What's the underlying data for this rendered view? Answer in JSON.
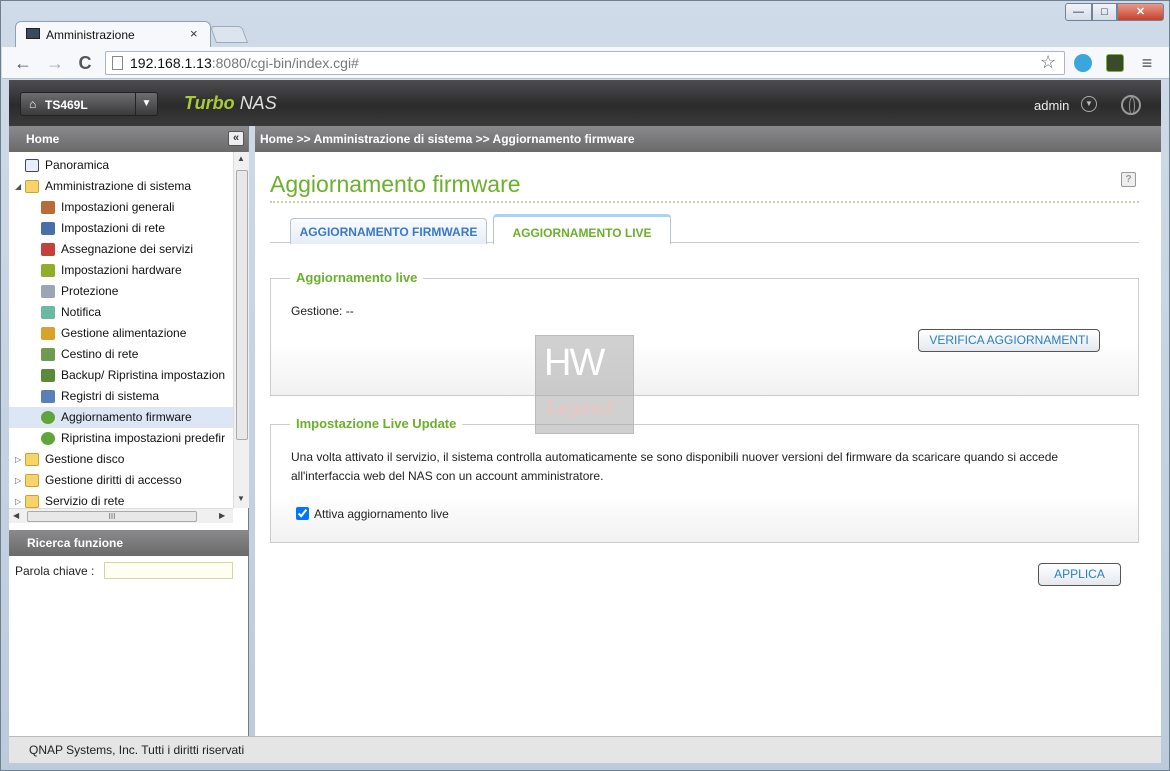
{
  "browser": {
    "tab_title": "Amministrazione",
    "tab_close": "×",
    "url_host": "192.168.1.13",
    "url_path": ":8080/cgi-bin/index.cgi#",
    "nav": {
      "back": "←",
      "forward": "→",
      "reload": "C",
      "menu": "≡",
      "star": "☆"
    },
    "window": {
      "min": "—",
      "max": "□",
      "close": "✕"
    }
  },
  "header": {
    "device": "TS469L",
    "brand_turbo": "Turbo",
    "brand_nas": "NAS",
    "user": "admin"
  },
  "sidebar": {
    "title": "Home",
    "collapse": "«",
    "tree": [
      {
        "label": "Panoramica",
        "icon": "overview-icon"
      },
      {
        "label": "Amministrazione di sistema",
        "icon": "folder-open-icon",
        "expanded": true
      },
      {
        "label": "Impostazioni generali",
        "icon": "general-settings-icon"
      },
      {
        "label": "Impostazioni di rete",
        "icon": "network-icon"
      },
      {
        "label": "Assegnazione dei servizi",
        "icon": "service-binding-icon"
      },
      {
        "label": "Impostazioni hardware",
        "icon": "hardware-icon"
      },
      {
        "label": "Protezione",
        "icon": "security-icon"
      },
      {
        "label": "Notifica",
        "icon": "notification-icon"
      },
      {
        "label": "Gestione alimentazione",
        "icon": "power-icon"
      },
      {
        "label": "Cestino di rete",
        "icon": "recycle-bin-icon"
      },
      {
        "label": "Backup/ Ripristina impostazion",
        "icon": "backup-icon"
      },
      {
        "label": "Registri di sistema",
        "icon": "logs-icon"
      },
      {
        "label": "Aggiornamento firmware",
        "icon": "firmware-icon",
        "selected": true
      },
      {
        "label": "Ripristina impostazioni predefir",
        "icon": "restore-icon"
      },
      {
        "label": "Gestione disco",
        "icon": "folder-icon"
      },
      {
        "label": "Gestione diritti di accesso",
        "icon": "folder-icon"
      },
      {
        "label": "Servizio di rete",
        "icon": "folder-icon"
      }
    ],
    "hscroll_grip": "III",
    "search_title": "Ricerca funzione",
    "keyword_label": "Parola chiave :",
    "keyword_value": ""
  },
  "main": {
    "breadcrumb": "Home >> Amministrazione di sistema >> Aggiornamento firmware",
    "title": "Aggiornamento firmware",
    "help": "?",
    "tabs": [
      {
        "label": "AGGIORNAMENTO FIRMWARE",
        "active": false
      },
      {
        "label": "AGGIORNAMENTO LIVE",
        "active": true
      }
    ],
    "live_update": {
      "legend": "Aggiornamento live",
      "gestione": "Gestione: --",
      "check_button": "VERIFICA AGGIORNAMENTI"
    },
    "live_settings": {
      "legend": "Impostazione Live Update",
      "description": "Una volta attivato il servizio, il sistema controlla automaticamente se sono disponibili nuover versioni del firmware da scaricare quando si accede all'interfaccia web del NAS con un account amministratore.",
      "checkbox_label": "Attiva aggiornamento live",
      "checked": true
    },
    "apply_button": "APPLICA",
    "watermark": {
      "top": "HW",
      "bottom": "Legend"
    }
  },
  "footer": "QNAP Systems, Inc. Tutti i diritti riservati",
  "colors": {
    "accent_green": "#6bb02b",
    "link_blue": "#2b7fc1",
    "header_dark": "#2b2b2c"
  }
}
